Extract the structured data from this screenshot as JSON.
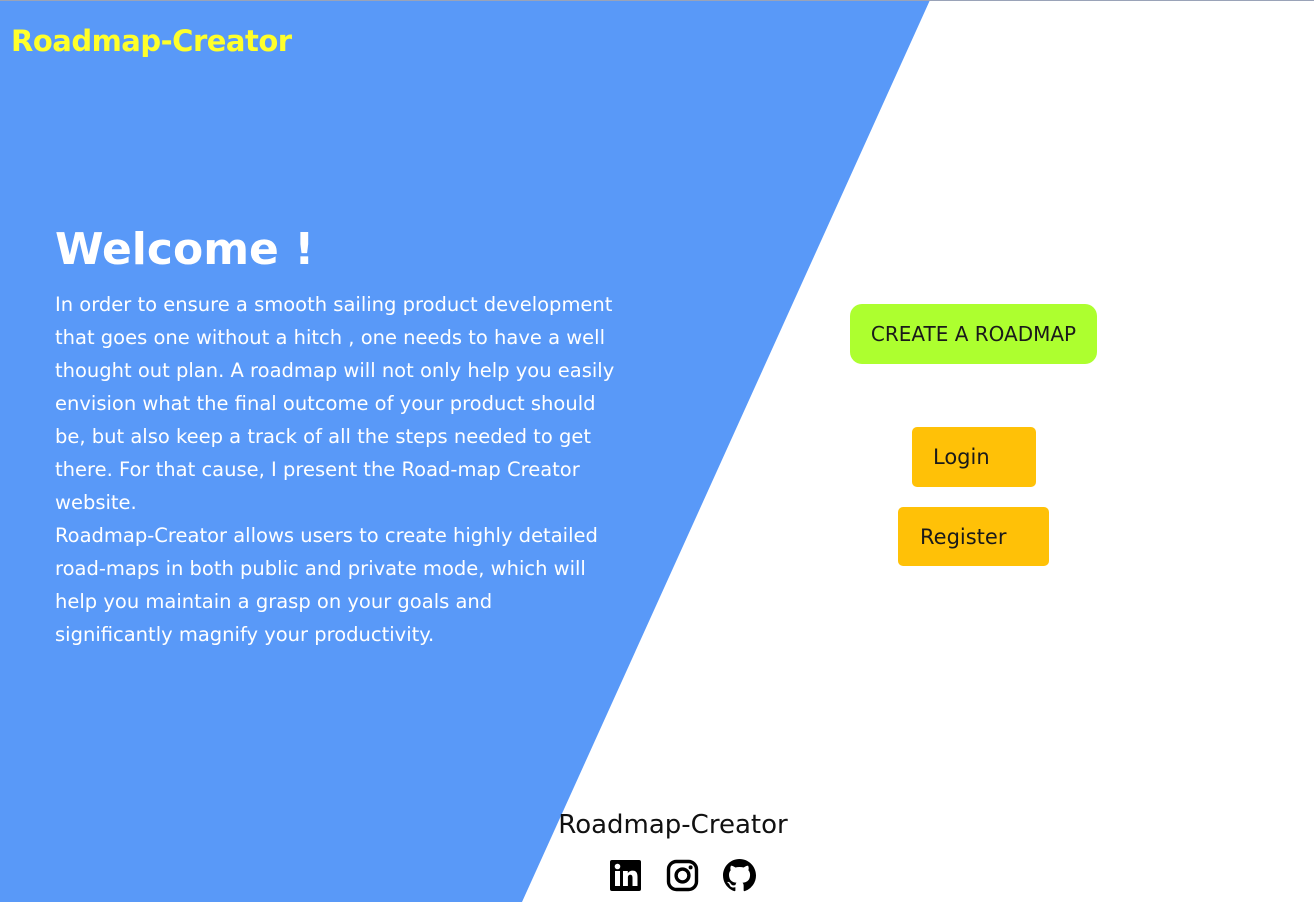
{
  "header": {
    "brand": "Roadmap-Creator"
  },
  "hero": {
    "title": "Welcome !",
    "paragraph_1": "In order to ensure a smooth sailing product development that goes one without a hitch , one needs to have a well thought out plan. A roadmap will not only help you easily envision what the final outcome of your product should be, but also keep a track of all the steps needed to get there. For that cause, I present the Road-map Creator website.",
    "paragraph_2": "Roadmap-Creator allows users to create highly detailed road-maps in both public and private mode, which will help you maintain a grasp on your goals and significantly magnify your productivity."
  },
  "actions": {
    "create_label": "CREATE A ROADMAP",
    "login_label": "Login",
    "register_label": "Register"
  },
  "footer": {
    "name": "Roadmap-Creator",
    "social_icons": [
      "linkedin-icon",
      "instagram-icon",
      "github-icon"
    ]
  },
  "colors": {
    "panel_blue": "#5999f8",
    "brand_yellow": "#ffff2a",
    "create_button": "#adff2f",
    "auth_button": "#ffc107",
    "page_background": "#ffffff"
  }
}
